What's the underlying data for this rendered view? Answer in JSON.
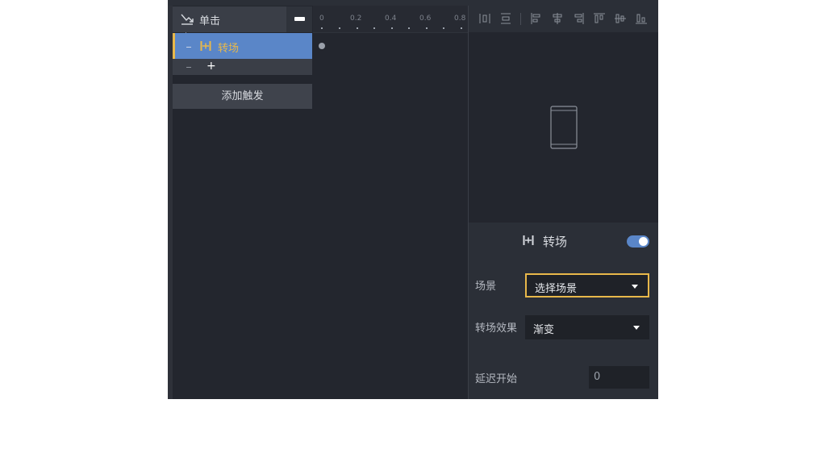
{
  "trigger": {
    "label": "单击",
    "action_label": "转场",
    "add_action": "+",
    "add_trigger_label": "添加触发"
  },
  "timeline": {
    "ticks": [
      "0",
      "0.2",
      "0.4",
      "0.6",
      "0.8"
    ]
  },
  "props": {
    "title": "转场",
    "enabled": true,
    "scene_label": "场景",
    "scene_value": "选择场景",
    "effect_label": "转场效果",
    "effect_value": "渐变",
    "delay_label": "延迟开始",
    "delay_value": "0"
  },
  "colors": {
    "accent": "#e8b84a",
    "selection": "#5a86c8",
    "panel": "#23262e"
  },
  "icons": {
    "trigger": "click-trigger-icon",
    "action": "transition-icon",
    "toolbar": [
      "align-distribute-horizontal-icon",
      "align-distribute-vertical-icon",
      "align-left-icon",
      "align-center-horizontal-icon",
      "align-right-icon",
      "align-top-icon",
      "align-center-vertical-icon",
      "align-bottom-icon"
    ],
    "preview": "phone-icon"
  }
}
